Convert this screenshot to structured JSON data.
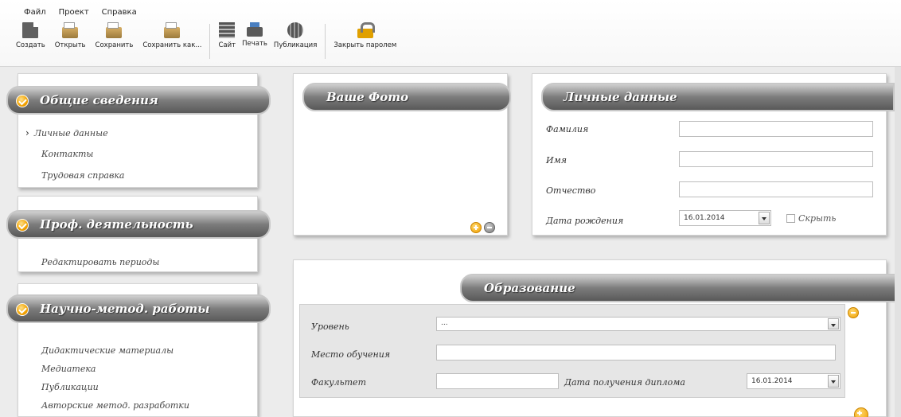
{
  "menu": [
    "Файл",
    "Проект",
    "Справка"
  ],
  "toolbar": {
    "group1": [
      {
        "label": "Создать",
        "icon": "new-document-icon"
      },
      {
        "label": "Открыть",
        "icon": "open-folder-icon"
      },
      {
        "label": "Сохранить",
        "icon": "save-folder-icon"
      },
      {
        "label": "Сохранить как...",
        "icon": "save-as-folder-icon"
      }
    ],
    "group2": [
      {
        "label": "Сайт",
        "icon": "site-icon"
      },
      {
        "label": "Печать",
        "icon": "printer-icon"
      },
      {
        "label": "Публикация",
        "icon": "globe-icon"
      }
    ],
    "group3": [
      {
        "label": "Закрыть паролем",
        "icon": "lock-icon"
      }
    ]
  },
  "sidebar": {
    "general": {
      "title": "Общие сведения",
      "items": [
        "Личные данные",
        "Контакты",
        "Трудовая справка"
      ],
      "active_marker": "›"
    },
    "prof": {
      "title": "Проф. деятельность",
      "items": [
        "Редактировать периоды"
      ]
    },
    "science": {
      "title": "Научно-метод. работы",
      "items": [
        "Дидактические материалы",
        "Медиатека",
        "Публикации",
        "Авторские метод. разработки"
      ]
    }
  },
  "photo": {
    "title": "Ваше Фото"
  },
  "personal": {
    "title": "Личные данные",
    "surname_label": "Фамилия",
    "surname_value": "",
    "name_label": "Имя",
    "name_value": "",
    "patronymic_label": "Отчество",
    "patronymic_value": "",
    "birthdate_label": "Дата рождения",
    "birthdate_value": "16.01.2014",
    "hide_label": "Скрыть"
  },
  "education": {
    "title": "Образование",
    "level_label": "Уровень",
    "level_value": "...",
    "place_label": "Место обучения",
    "place_value": "",
    "faculty_label": "Факультет",
    "faculty_value": "",
    "diploma_label": "Дата получения диплома",
    "diploma_value": "16.01.2014"
  },
  "colors": {
    "accent": "#f2a200",
    "ribbon_dark": "#595959",
    "ribbon_light": "#cfcfcf"
  }
}
